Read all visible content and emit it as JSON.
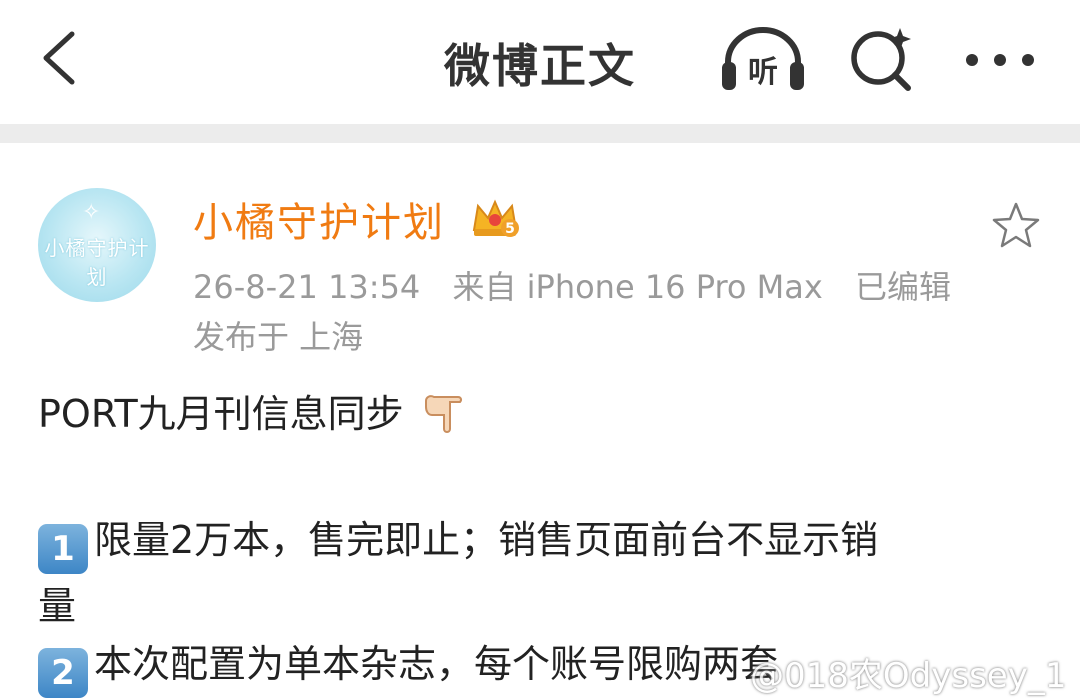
{
  "header": {
    "title": "微博正文",
    "listen_label": "听"
  },
  "author": {
    "name": "小橘守护计划",
    "avatar_text": "小橘守护计划",
    "badge_level": "5",
    "time": "26-8-21 13:54",
    "source": "来自 iPhone 16 Pro Max",
    "edited": "已编辑",
    "location": "发布于 上海"
  },
  "post": {
    "line1": "PORT九月刊信息同步",
    "item1_num": "1",
    "item1_text": "限量2万本，售完即止；销售页面前台不显示销",
    "item1_cont": "量",
    "item2_num": "2",
    "item2_text": "本次配置为单本杂志，每个账号限购两套"
  },
  "watermark": "@018农Odyssey_1",
  "colors": {
    "username": "#f07b12",
    "meta": "#9a9a9a",
    "divider": "#ececec",
    "badge_blue": "#3d86c6"
  }
}
